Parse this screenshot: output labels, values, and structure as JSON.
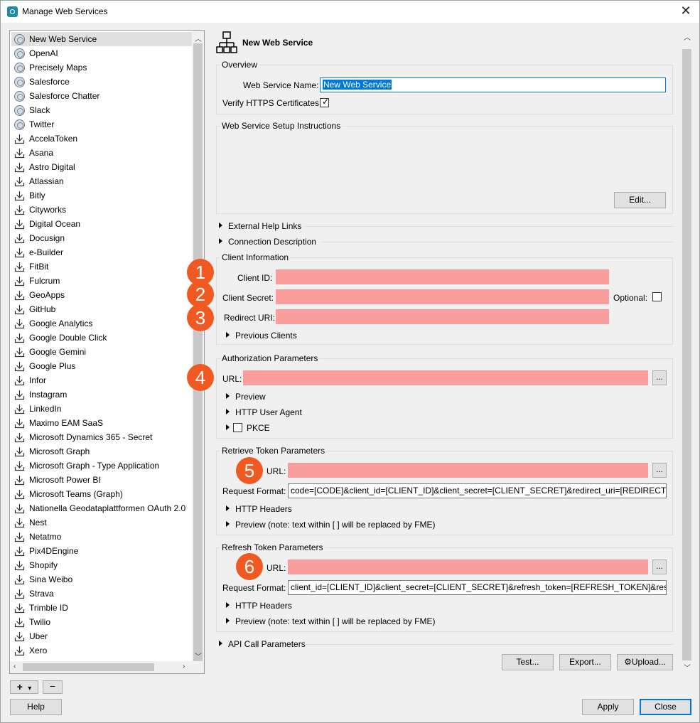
{
  "window": {
    "title": "Manage Web Services",
    "close_glyph": "✕"
  },
  "services": [
    {
      "label": "New Web Service",
      "icon": "globe-icon"
    },
    {
      "label": "OpenAI",
      "icon": "globe-icon"
    },
    {
      "label": "Precisely Maps",
      "icon": "globe-icon"
    },
    {
      "label": "Salesforce",
      "icon": "globe-icon"
    },
    {
      "label": "Salesforce Chatter",
      "icon": "globe-icon"
    },
    {
      "label": "Slack",
      "icon": "globe-icon"
    },
    {
      "label": "Twitter",
      "icon": "globe-icon"
    },
    {
      "label": "AccelaToken",
      "icon": "download-icon"
    },
    {
      "label": "Asana",
      "icon": "download-icon"
    },
    {
      "label": "Astro Digital",
      "icon": "download-icon"
    },
    {
      "label": "Atlassian",
      "icon": "download-icon"
    },
    {
      "label": "Bitly",
      "icon": "download-icon"
    },
    {
      "label": "Cityworks",
      "icon": "download-icon"
    },
    {
      "label": "Digital Ocean",
      "icon": "download-icon"
    },
    {
      "label": "Docusign",
      "icon": "download-icon"
    },
    {
      "label": "e-Builder",
      "icon": "download-icon"
    },
    {
      "label": "FitBit",
      "icon": "download-icon"
    },
    {
      "label": "Fulcrum",
      "icon": "download-icon"
    },
    {
      "label": "GeoApps",
      "icon": "download-icon"
    },
    {
      "label": "GitHub",
      "icon": "download-icon"
    },
    {
      "label": "Google Analytics",
      "icon": "download-icon"
    },
    {
      "label": "Google Double Click",
      "icon": "download-icon"
    },
    {
      "label": "Google Gemini",
      "icon": "download-icon"
    },
    {
      "label": "Google Plus",
      "icon": "download-icon"
    },
    {
      "label": "Infor",
      "icon": "download-icon"
    },
    {
      "label": "Instagram",
      "icon": "download-icon"
    },
    {
      "label": "LinkedIn",
      "icon": "download-icon"
    },
    {
      "label": "Maximo EAM SaaS",
      "icon": "download-icon"
    },
    {
      "label": "Microsoft Dynamics 365 - Secret",
      "icon": "download-icon"
    },
    {
      "label": "Microsoft Graph",
      "icon": "download-icon"
    },
    {
      "label": "Microsoft Graph - Type Application",
      "icon": "download-icon"
    },
    {
      "label": "Microsoft Power BI",
      "icon": "download-icon"
    },
    {
      "label": "Microsoft Teams (Graph)",
      "icon": "download-icon"
    },
    {
      "label": "Nationella Geodataplattformen OAuth 2.0",
      "icon": "download-icon"
    },
    {
      "label": "Nest",
      "icon": "download-icon"
    },
    {
      "label": "Netatmo",
      "icon": "download-icon"
    },
    {
      "label": "Pix4DEngine",
      "icon": "download-icon"
    },
    {
      "label": "Shopify",
      "icon": "download-icon"
    },
    {
      "label": "Sina Weibo",
      "icon": "download-icon"
    },
    {
      "label": "Strava",
      "icon": "download-icon"
    },
    {
      "label": "Trimble ID",
      "icon": "download-icon"
    },
    {
      "label": "Twilio",
      "icon": "download-icon"
    },
    {
      "label": "Uber",
      "icon": "download-icon"
    },
    {
      "label": "Xero",
      "icon": "download-icon"
    }
  ],
  "list_controls": {
    "add": "+",
    "add_dropdown": "▾",
    "remove": "−"
  },
  "header": {
    "title": "New Web Service"
  },
  "overview": {
    "title": "Overview",
    "name_label": "Web Service Name:",
    "name_value": "New Web Service",
    "verify_label": "Verify HTTPS Certificates:",
    "verify_checked": true
  },
  "setup": {
    "title": "Web Service Setup Instructions",
    "edit_button": "Edit..."
  },
  "external_help": "External Help Links",
  "connection_description": "Connection Description",
  "client": {
    "title": "Client Information",
    "client_id_label": "Client ID:",
    "client_secret_label": "Client Secret:",
    "optional_label": "Optional:",
    "redirect_label": "Redirect URI:",
    "previous_clients": "Previous Clients"
  },
  "authorization": {
    "title": "Authorization Parameters",
    "url_label": "URL:",
    "preview": "Preview",
    "user_agent": "HTTP User Agent",
    "pkce": "PKCE"
  },
  "retrieve_token": {
    "title": "Retrieve Token Parameters",
    "url_label": "URL:",
    "request_format_label": "Request Format:",
    "request_format_value": "code=[CODE]&client_id=[CLIENT_ID]&client_secret=[CLIENT_SECRET]&redirect_uri=[REDIRECT_URI]",
    "http_headers": "HTTP Headers",
    "preview": "Preview (note: text within [ ] will be replaced by FME)"
  },
  "refresh_token": {
    "title": "Refresh Token Parameters",
    "url_label": "URL:",
    "request_format_label": "Request Format:",
    "request_format_value": "client_id=[CLIENT_ID]&client_secret=[CLIENT_SECRET]&refresh_token=[REFRESH_TOKEN]&response",
    "http_headers": "HTTP Headers",
    "preview": "Preview (note: text within [ ] will be replaced by FME)"
  },
  "api_call": "API Call Parameters",
  "ellipsis": "...",
  "actions": {
    "test": "Test...",
    "export": "Export...",
    "upload": "Upload..."
  },
  "footer": {
    "help": "Help",
    "apply": "Apply",
    "close": "Close"
  },
  "badges": [
    "1",
    "2",
    "3",
    "4",
    "5",
    "6"
  ],
  "colors": {
    "redaction": "#f99d9d",
    "badge": "#f05a22",
    "focus": "#0078d7"
  }
}
